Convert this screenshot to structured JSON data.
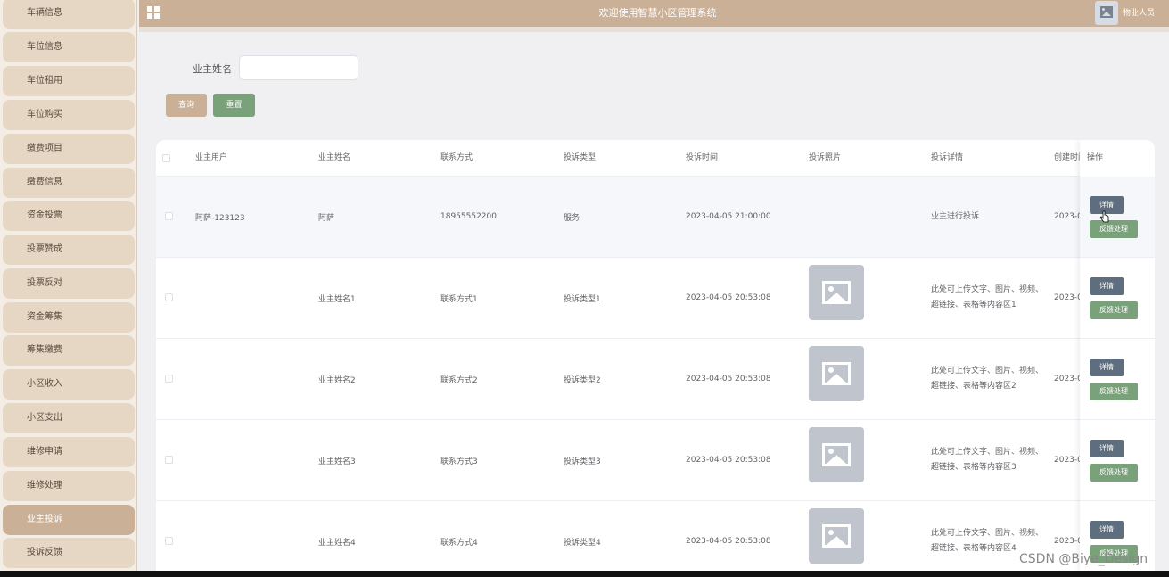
{
  "header": {
    "title": "欢迎使用智慧小区管理系统",
    "user": "物业人员"
  },
  "sidebar": {
    "items": [
      "车辆信息",
      "车位信息",
      "车位租用",
      "车位购买",
      "缴费项目",
      "缴费信息",
      "资金投票",
      "投票赞成",
      "投票反对",
      "资金筹集",
      "筹集缴费",
      "小区收入",
      "小区支出",
      "维修申请",
      "维修处理",
      "业主投诉",
      "投诉反馈"
    ],
    "active": "业主投诉"
  },
  "search": {
    "label": "业主姓名",
    "value": "",
    "query_label": "查询",
    "reset_label": "重置"
  },
  "table": {
    "columns": [
      "业主用户",
      "业主姓名",
      "联系方式",
      "投诉类型",
      "投诉时间",
      "投诉照片",
      "投诉详情",
      "创建时间",
      "操作"
    ],
    "rows": [
      {
        "user": "阿萨-123123",
        "name": "阿萨",
        "phone": "18955552200",
        "type": "服务",
        "time": "2023-04-05 21:00:00",
        "photo": false,
        "detail": "业主进行投诉",
        "created": "2023-0"
      },
      {
        "user": "",
        "name": "业主姓名1",
        "phone": "联系方式1",
        "type": "投诉类型1",
        "time": "2023-04-05 20:53:08",
        "photo": true,
        "detail": "此处可上传文字、图片、视频、超链接、表格等内容区1",
        "created": "2023-0"
      },
      {
        "user": "",
        "name": "业主姓名2",
        "phone": "联系方式2",
        "type": "投诉类型2",
        "time": "2023-04-05 20:53:08",
        "photo": true,
        "detail": "此处可上传文字、图片、视频、超链接、表格等内容区2",
        "created": "2023-0"
      },
      {
        "user": "",
        "name": "业主姓名3",
        "phone": "联系方式3",
        "type": "投诉类型3",
        "time": "2023-04-05 20:53:08",
        "photo": true,
        "detail": "此处可上传文字、图片、视频、超链接、表格等内容区3",
        "created": "2023-0"
      },
      {
        "user": "",
        "name": "业主姓名4",
        "phone": "联系方式4",
        "type": "投诉类型4",
        "time": "2023-04-05 20:53:08",
        "photo": true,
        "detail": "此处可上传文字、图片、视频、超链接、表格等内容区4",
        "created": "2023-0"
      }
    ],
    "detail_button": "详情",
    "feedback_button": "反馈处理"
  },
  "watermark": "CSDN @Biye_Design",
  "colors": {
    "accent": "#c9b096",
    "sidebar_item": "#e6d7c5",
    "green": "#7aa27a",
    "slate": "#5e6e7e"
  }
}
